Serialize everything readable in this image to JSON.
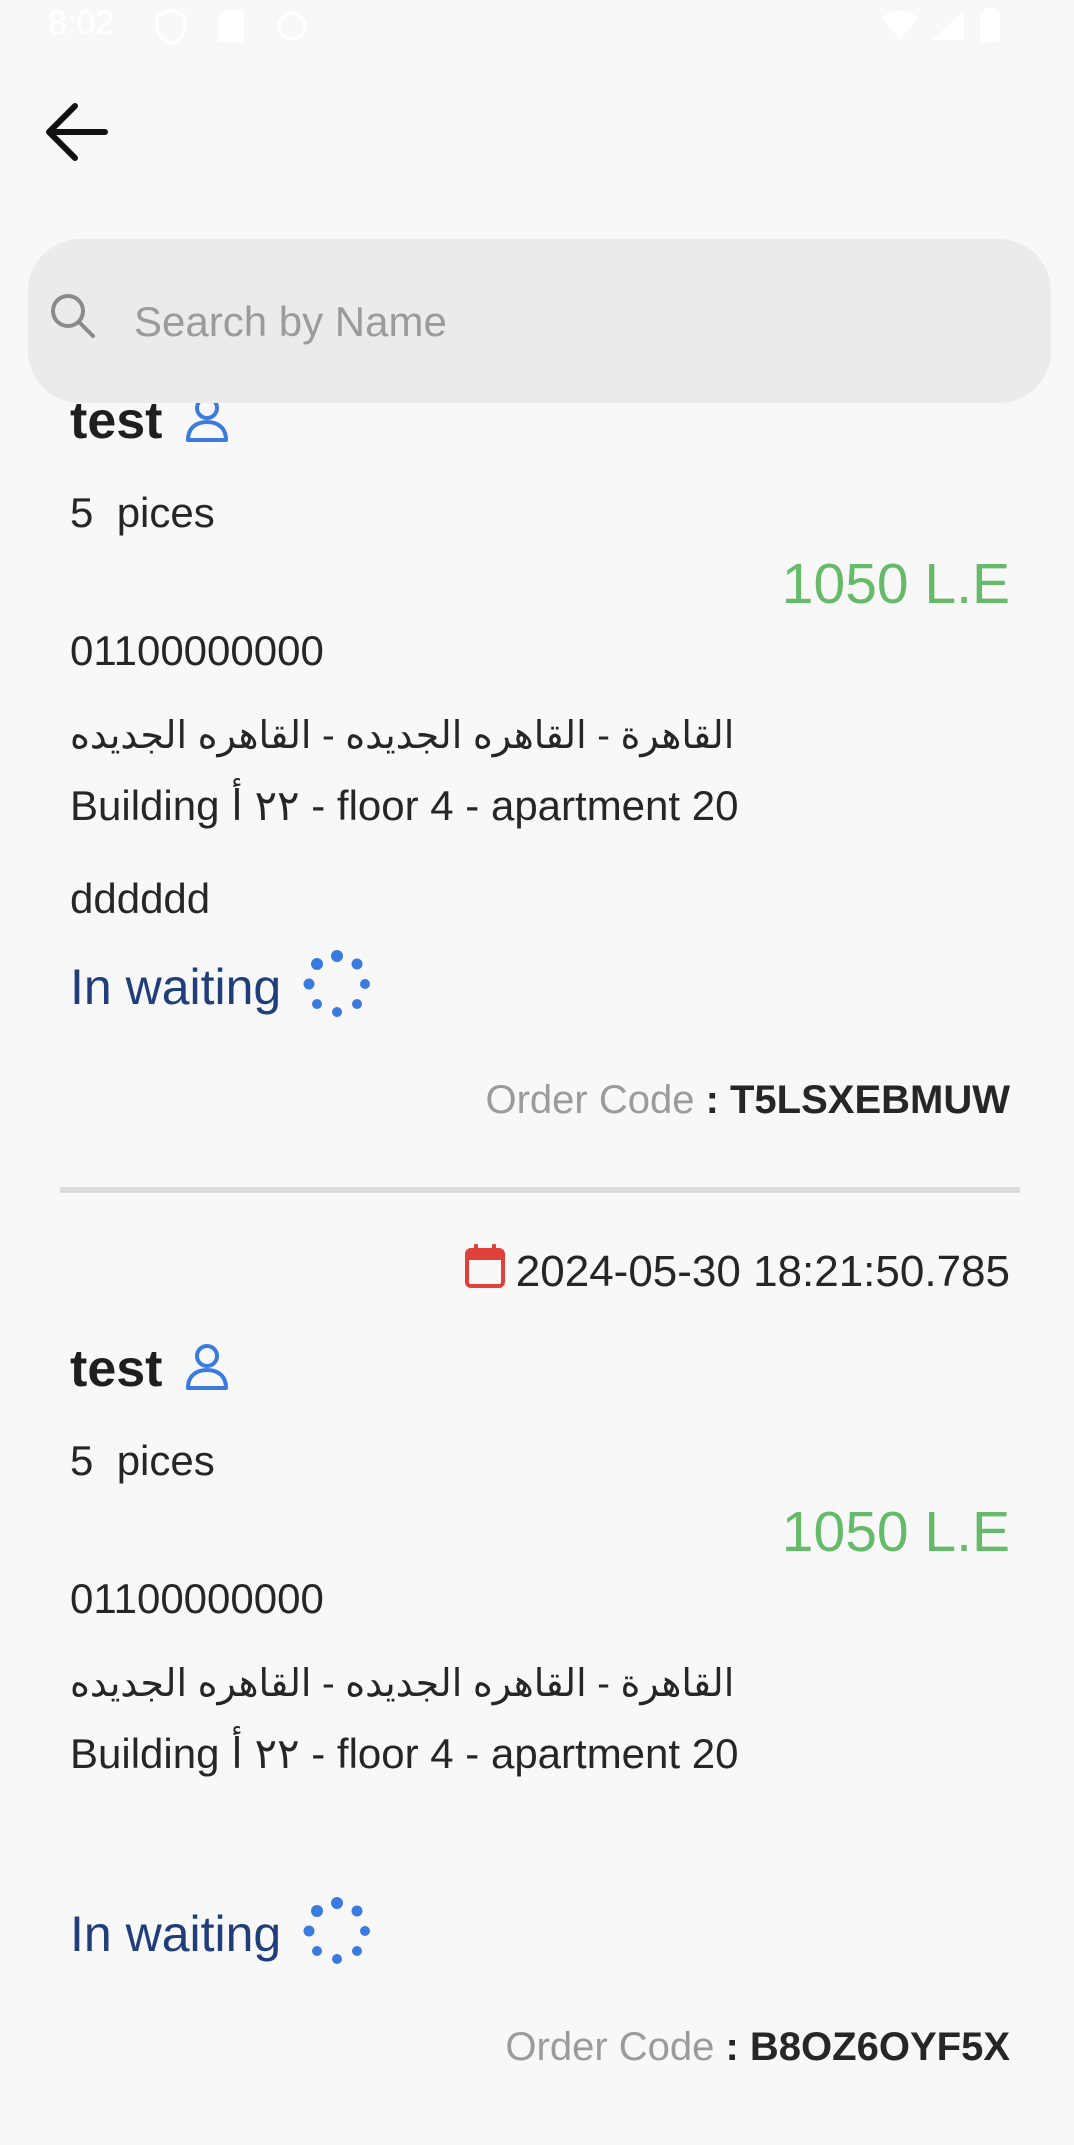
{
  "status_bar": {
    "time": "8:02",
    "icons": [
      "shield-icon",
      "sd-card-icon",
      "sync-icon",
      "wifi-icon",
      "signal-icon",
      "battery-icon"
    ]
  },
  "nav": {
    "back_icon": "arrow-left-icon"
  },
  "search": {
    "placeholder": "Search by Name",
    "value": "",
    "icon": "search-icon"
  },
  "colors": {
    "price": "#66bb6a",
    "status": "#1f3e7a",
    "accent_blue": "#3b7be0",
    "calendar_red": "#e0413b",
    "search_bg": "#ebebeb"
  },
  "orders": [
    {
      "date": "",
      "customer": "test",
      "pieces_count": "5",
      "pieces_unit": "pices",
      "price": "1050 L.E",
      "phone": "01100000000",
      "area": "القاهرة - القاهره الجديده - القاهره الجديده",
      "address": "Building ٢٢ أ - floor 4 - apartment 20",
      "notes": "dddddd",
      "status": "In waiting",
      "code_label": "Order Code",
      "code_sep": " : ",
      "code": "T5LSXEBMUW"
    },
    {
      "date": "2024-05-30 18:21:50.785",
      "customer": "test",
      "pieces_count": "5",
      "pieces_unit": "pices",
      "price": "1050 L.E",
      "phone": "01100000000",
      "area": "القاهرة - القاهره الجديده - القاهره الجديده",
      "address": "Building ٢٢ أ - floor 4 - apartment 20",
      "notes": "",
      "status": "In waiting",
      "code_label": "Order Code",
      "code_sep": " : ",
      "code": "B8OZ6OYF5X"
    }
  ]
}
